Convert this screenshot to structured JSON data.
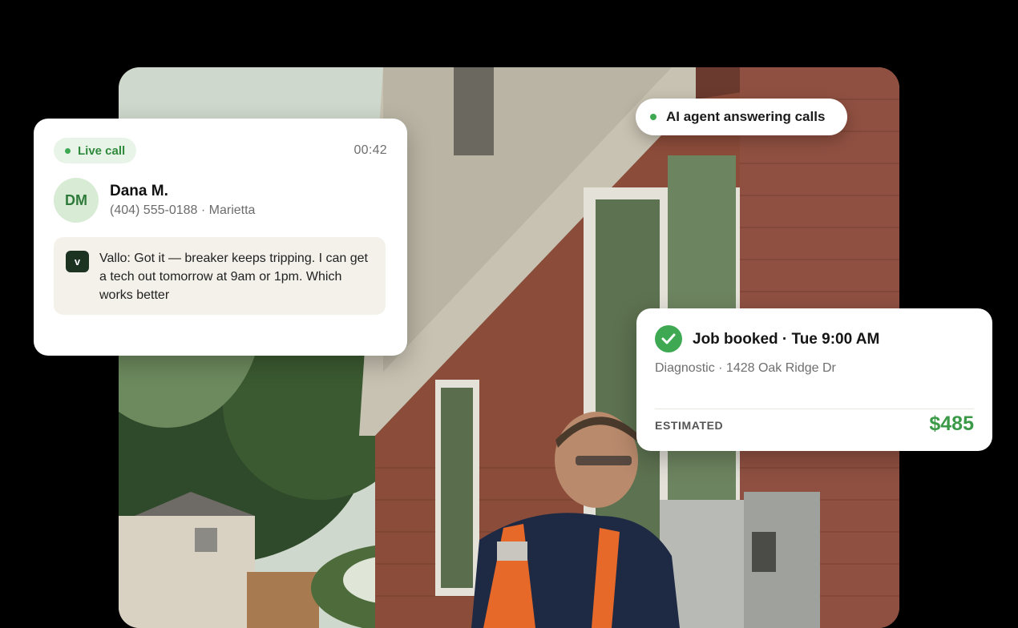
{
  "call_card": {
    "status": "Live call",
    "timer": "00:42",
    "avatar_initials": "DM",
    "caller_name": "Dana M.",
    "caller_details": "(404) 555-0188 · Marietta",
    "agent_badge": "v",
    "transcript": "Vallo: Got it — breaker keeps tripping. I can get a tech out tomorrow at 9am or 1pm. Which works better"
  },
  "agent_pill": {
    "label": "AI agent answering calls"
  },
  "job_card": {
    "title": "Job booked · Tue 9:00 AM",
    "details": "Diagnostic · 1428 Oak Ridge Dr",
    "estimate_label": "ESTIMATED",
    "estimate_value": "$485"
  },
  "colors": {
    "accent_green": "#3ea952",
    "badge_dark": "#1d3322",
    "page_background": "#000000"
  },
  "icons": [
    "check-icon",
    "status-dot-icon"
  ]
}
